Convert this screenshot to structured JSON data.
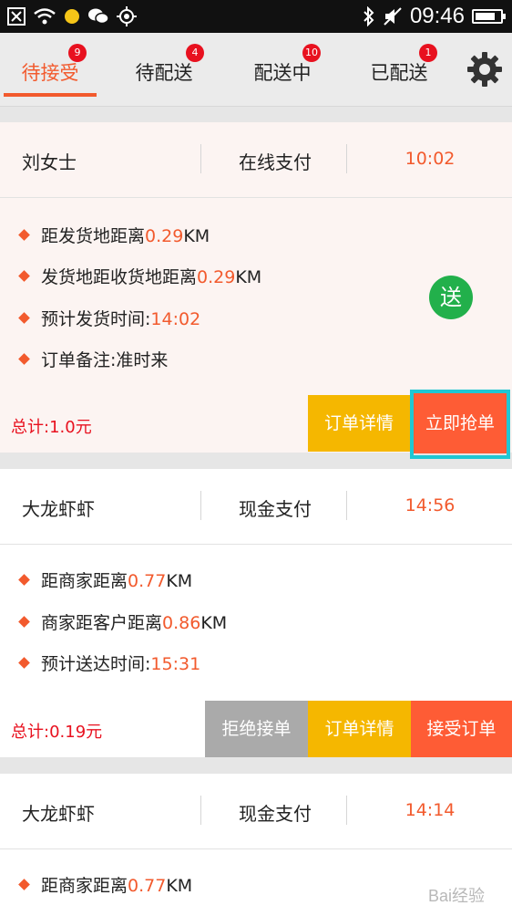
{
  "status_bar": {
    "time": "09:46",
    "battery_level": 0.8
  },
  "tabs": [
    {
      "label": "待接受",
      "badge": "9",
      "active": true
    },
    {
      "label": "待配送",
      "badge": "4"
    },
    {
      "label": "配送中",
      "badge": "10"
    },
    {
      "label": "已配送",
      "badge": "1"
    }
  ],
  "orders": [
    {
      "name": "刘女士",
      "payment": "在线支付",
      "time": "10:02",
      "lines": [
        {
          "label": "距发货地距离",
          "value": "0.29",
          "unit": "KM"
        },
        {
          "label": "发货地距收货地距离",
          "value": "0.29",
          "unit": "KM"
        },
        {
          "label": "预计发货时间:",
          "value": "14:02",
          "unit": ""
        },
        {
          "label": "订单备注:准时来",
          "value": "",
          "unit": ""
        }
      ],
      "badge": "送",
      "total": "总计:1.0元",
      "buttons": [
        "订单详情",
        "立即抢单"
      ]
    },
    {
      "name": "大龙虾虾",
      "payment": "现金支付",
      "time": "14:56",
      "lines": [
        {
          "label": "距商家距离",
          "value": "0.77",
          "unit": "KM"
        },
        {
          "label": "商家距客户距离",
          "value": "0.86",
          "unit": "KM"
        },
        {
          "label": "预计送达时间:",
          "value": "15:31",
          "unit": ""
        }
      ],
      "total": "总计:0.19元",
      "buttons": [
        "拒绝接单",
        "订单详情",
        "接受订单"
      ]
    },
    {
      "name": "大龙虾虾",
      "payment": "现金支付",
      "time": "14:14",
      "lines": [
        {
          "label": "距商家距离",
          "value": "0.77",
          "unit": "KM"
        }
      ]
    }
  ],
  "colors": {
    "accent": "#f25a2d",
    "yellow": "#f5b700",
    "orange": "#fe5c35",
    "gray": "#aaaaaa",
    "green": "#22b04b",
    "red": "#e8111f",
    "highlight": "#1ec7d3"
  },
  "watermark": "Bai经验"
}
